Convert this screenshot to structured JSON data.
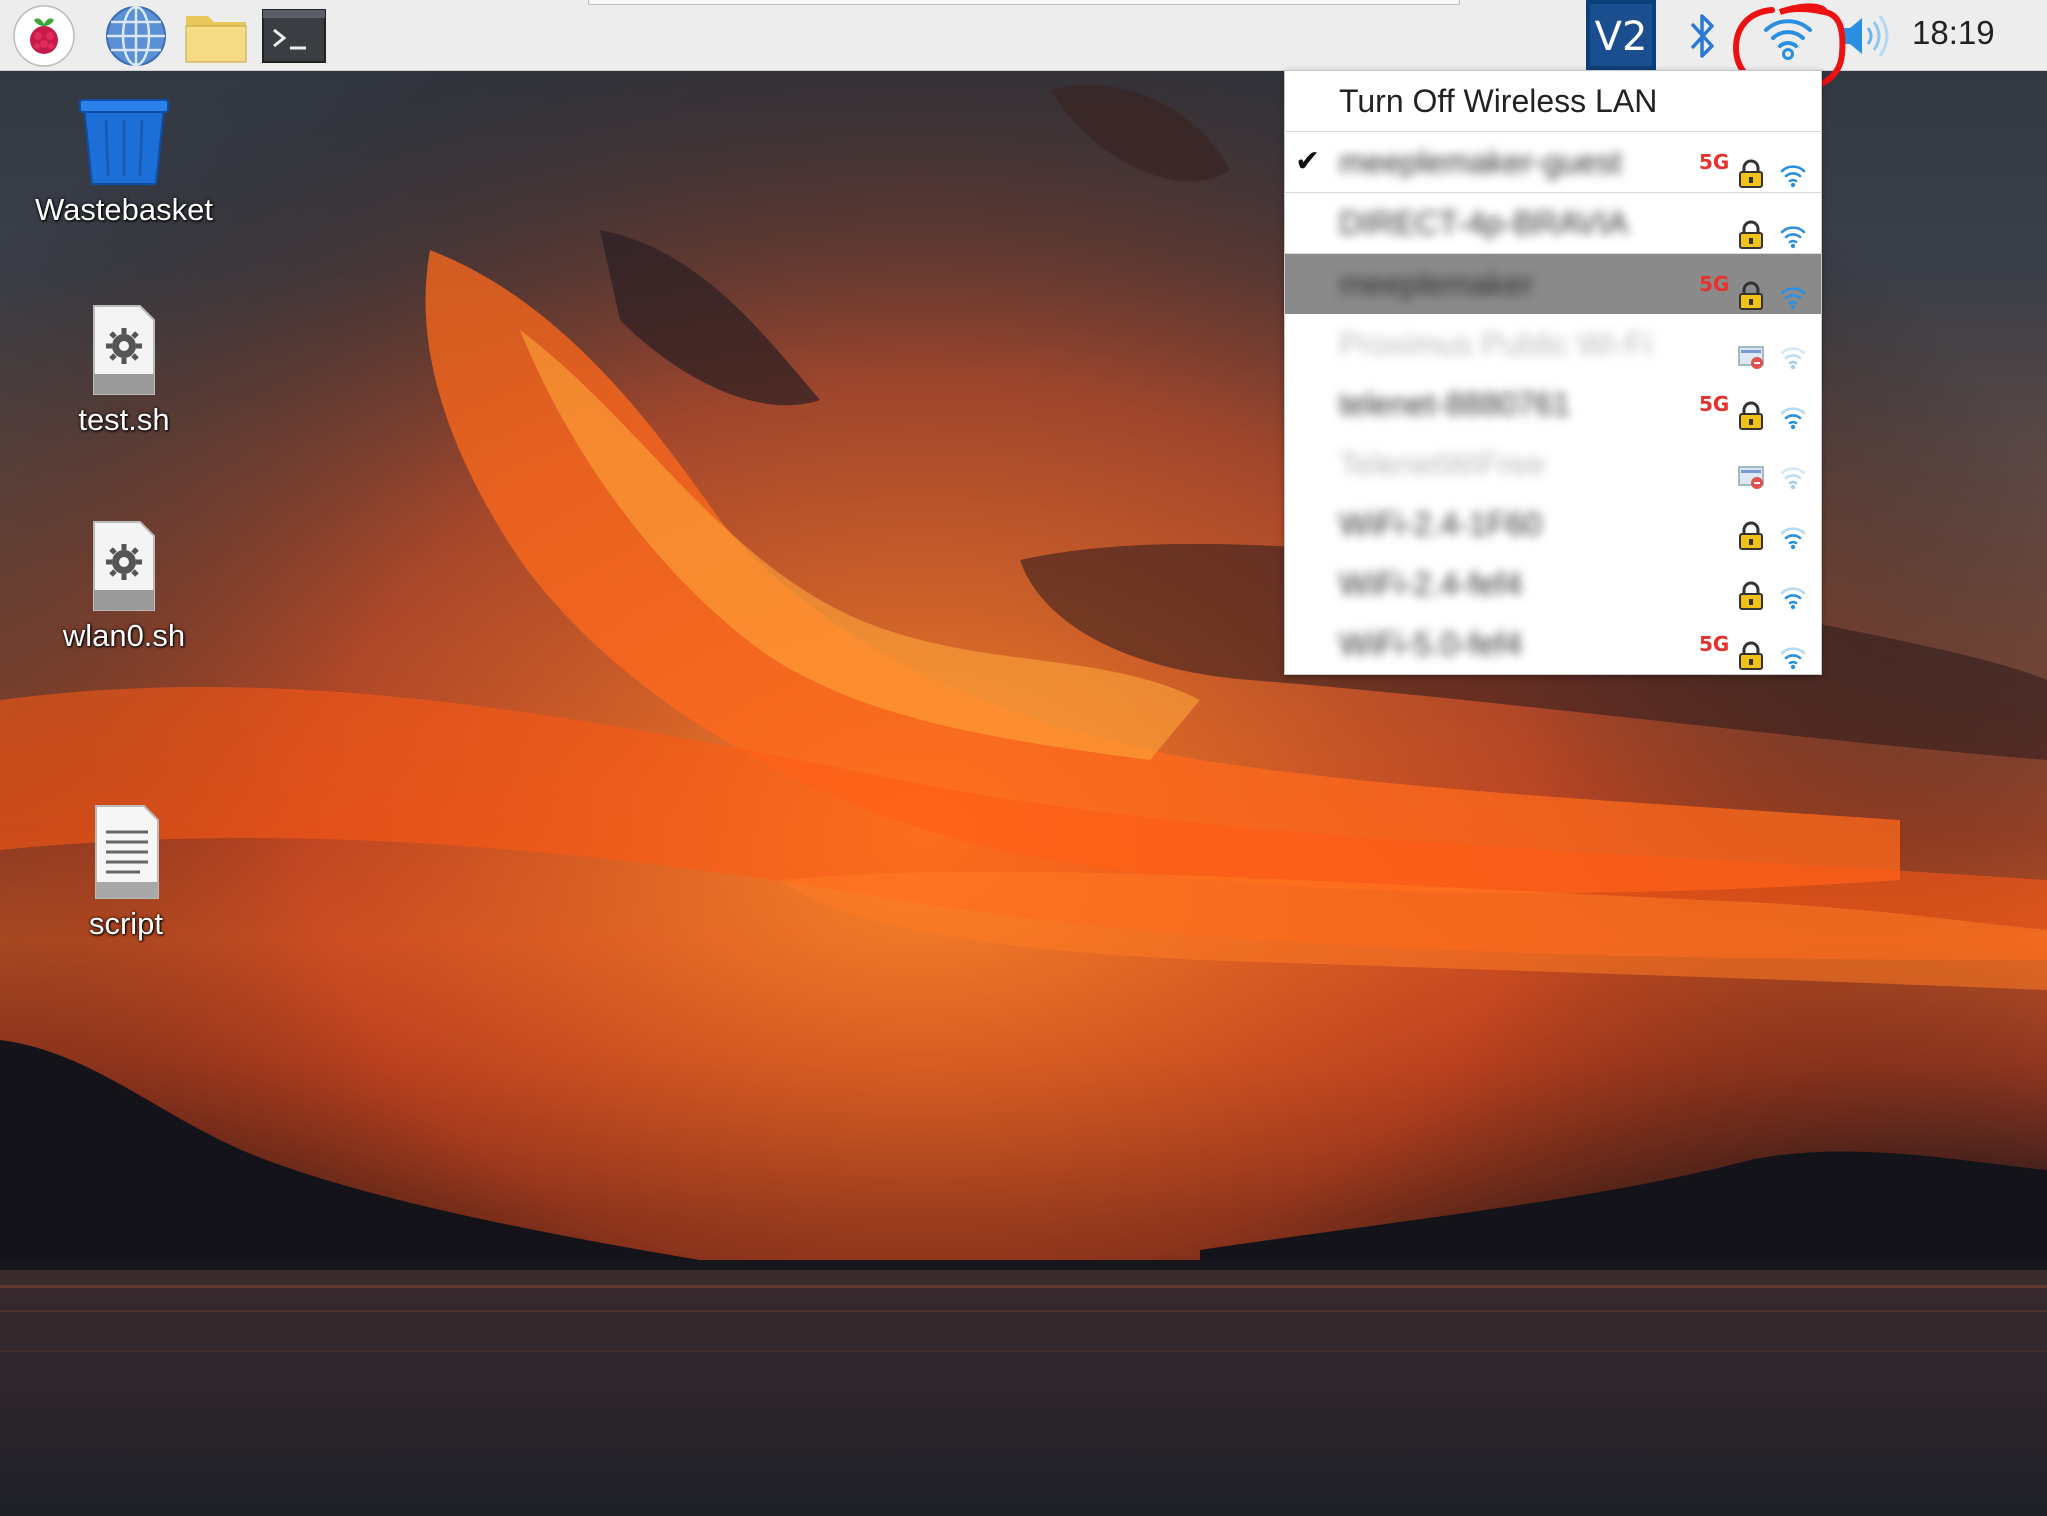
{
  "taskbar": {
    "launchers": [
      {
        "name": "raspberry-menu",
        "icon": "raspberry-icon"
      },
      {
        "name": "web-browser",
        "icon": "globe-icon"
      },
      {
        "name": "file-manager",
        "icon": "folder-icon"
      },
      {
        "name": "terminal",
        "icon": "terminal-icon"
      }
    ],
    "tray": {
      "vnc_label": "V2",
      "icons": [
        "vnc-icon",
        "bluetooth-icon",
        "wifi-icon",
        "volume-icon"
      ],
      "clock": "18:19"
    }
  },
  "desktop": {
    "items": [
      {
        "label": "Wastebasket",
        "icon": "trash-icon"
      },
      {
        "label": "test.sh",
        "icon": "script-gear-icon"
      },
      {
        "label": "wlan0.sh",
        "icon": "script-gear-icon"
      },
      {
        "label": "script",
        "icon": "text-file-icon"
      }
    ]
  },
  "wifi_menu": {
    "toggle_label": "Turn Off Wireless LAN",
    "networks": [
      {
        "ssid": "meeplemaker-guest",
        "connected": true,
        "band": "5G",
        "secured": true,
        "signal": "full"
      },
      {
        "ssid": "DIRECT-4p-BRAVIA",
        "connected": false,
        "band": "",
        "secured": true,
        "signal": "full"
      },
      {
        "ssid": "meeplemaker",
        "connected": false,
        "band": "5G",
        "secured": true,
        "signal": "full"
      },
      {
        "ssid": "Proximus Public Wi-Fi",
        "connected": false,
        "band": "",
        "secured": false,
        "signal": "weak"
      },
      {
        "ssid": "telenet-8880761",
        "connected": false,
        "band": "5G",
        "secured": true,
        "signal": "medium"
      },
      {
        "ssid": "TelenetWiFree",
        "connected": false,
        "band": "",
        "secured": false,
        "signal": "weak"
      },
      {
        "ssid": "WiFi-2.4-1F60",
        "connected": false,
        "band": "",
        "secured": true,
        "signal": "medium"
      },
      {
        "ssid": "WiFi-2.4-fef4",
        "connected": false,
        "band": "",
        "secured": true,
        "signal": "medium"
      },
      {
        "ssid": "WiFi-5.0-fef4",
        "connected": false,
        "band": "5G",
        "secured": true,
        "signal": "medium"
      }
    ]
  },
  "colors": {
    "taskbar_bg": "#ededed",
    "wifi_blue": "#2a8fe0",
    "band_red": "#e5322d",
    "annotation_red": "#ee1111",
    "menu_hover": "#8a8a8a"
  }
}
